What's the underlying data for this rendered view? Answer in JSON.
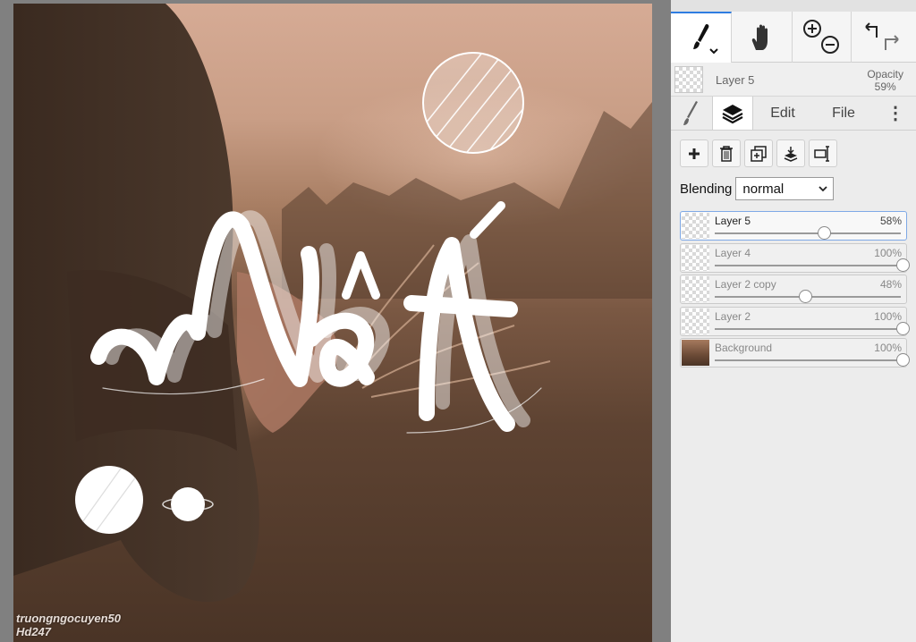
{
  "watermark": {
    "line1": "truongngocuyen50",
    "line2": "Hd247"
  },
  "artwork": {
    "lettering_text": "Mất",
    "colors": {
      "sky": "#d6ab95",
      "ground": "#4a3426",
      "lettering": "#ffffff"
    }
  },
  "toolbar": {
    "brush_icon": "brush-icon",
    "hand_icon": "hand-icon",
    "zoom_in_icon": "zoom-in-icon",
    "zoom_out_icon": "zoom-out-icon",
    "undo_icon": "undo-icon",
    "redo_icon": "redo-icon"
  },
  "current_layer": {
    "name": "Layer 5",
    "opacity_label": "Opacity",
    "opacity_value": "59%"
  },
  "tabs": {
    "edit": "Edit",
    "file": "File",
    "more": "⋮"
  },
  "blending": {
    "label": "Blending",
    "value": "normal"
  },
  "layers": [
    {
      "name": "Layer 5",
      "opacity": "58%",
      "opacity_frac": 0.58,
      "selected": true,
      "thumb": "transparent"
    },
    {
      "name": "Layer 4",
      "opacity": "100%",
      "opacity_frac": 1.0,
      "selected": false,
      "thumb": "transparent"
    },
    {
      "name": "Layer 2 copy",
      "opacity": "48%",
      "opacity_frac": 0.48,
      "selected": false,
      "thumb": "transparent"
    },
    {
      "name": "Layer 2",
      "opacity": "100%",
      "opacity_frac": 1.0,
      "selected": false,
      "thumb": "transparent"
    },
    {
      "name": "Background",
      "opacity": "100%",
      "opacity_frac": 1.0,
      "selected": false,
      "thumb": "image"
    }
  ],
  "accent_color": "#2f7de1"
}
